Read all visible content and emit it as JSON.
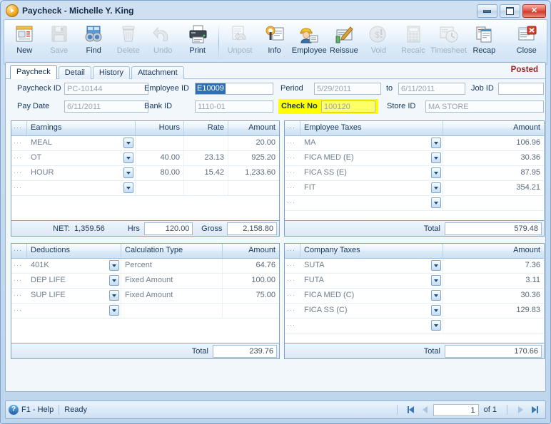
{
  "window": {
    "title": "Paycheck - Michelle Y. King",
    "app_icon": "paycheck-app-icon",
    "minimize_label": "Minimize",
    "maximize_label": "Maximize",
    "close_label": "Close",
    "accent_color": "#2f6fb5",
    "highlight_color": "#ffff00",
    "posted_color": "#9a1f1f"
  },
  "toolbar": {
    "items": [
      {
        "label": "New",
        "icon": "new-document-icon",
        "disabled": false
      },
      {
        "label": "Save",
        "icon": "floppy-disk-icon",
        "disabled": true
      },
      {
        "label": "Find",
        "icon": "binoculars-icon",
        "disabled": false
      },
      {
        "label": "Delete",
        "icon": "trash-can-icon",
        "disabled": true
      },
      {
        "label": "Undo",
        "icon": "undo-arrow-icon",
        "disabled": true
      },
      {
        "label": "Print",
        "icon": "printer-icon",
        "disabled": false
      },
      {
        "label": "Unpost",
        "icon": "unpost-icon",
        "disabled": true
      },
      {
        "label": "Info",
        "icon": "info-icon",
        "disabled": false
      },
      {
        "label": "Employee",
        "icon": "employee-icon",
        "disabled": false
      },
      {
        "label": "Reissue",
        "icon": "reissue-icon",
        "disabled": false
      },
      {
        "label": "Void",
        "icon": "void-icon",
        "disabled": true
      },
      {
        "label": "Recalc",
        "icon": "calculator-icon",
        "disabled": true
      },
      {
        "label": "Timesheet",
        "icon": "timesheet-icon",
        "disabled": true
      },
      {
        "label": "Recap",
        "icon": "recap-icon",
        "disabled": false
      },
      {
        "label": "Close",
        "icon": "close-window-icon",
        "disabled": false
      }
    ]
  },
  "tabs": [
    {
      "label": "Paycheck",
      "active": true
    },
    {
      "label": "Detail",
      "active": false
    },
    {
      "label": "History",
      "active": false
    },
    {
      "label": "Attachment",
      "active": false
    }
  ],
  "status_label": "Posted",
  "form": {
    "paycheck_id": {
      "label": "Paycheck ID",
      "value": "PC-10144"
    },
    "pay_date": {
      "label": "Pay Date",
      "value": "6/11/2011"
    },
    "employee_id": {
      "label": "Employee ID",
      "value": "E10009"
    },
    "bank_id": {
      "label": "Bank ID",
      "value": "1110-01"
    },
    "period": {
      "label": "Period",
      "value": "5/29/2011"
    },
    "period_to": {
      "label": "to",
      "value": "6/11/2011"
    },
    "check_no": {
      "label": "Check No",
      "value": "100120"
    },
    "job_id": {
      "label": "Job ID",
      "value": ""
    },
    "store_id": {
      "label": "Store ID",
      "value": "MA STORE"
    }
  },
  "earnings": {
    "columns": [
      "Earnings",
      "Hours",
      "Rate",
      "Amount"
    ],
    "rows": [
      {
        "name": "MEAL",
        "hours": "",
        "rate": "",
        "amount": "20.00"
      },
      {
        "name": "OT",
        "hours": "40.00",
        "rate": "23.13",
        "amount": "925.20"
      },
      {
        "name": "HOUR",
        "hours": "80.00",
        "rate": "15.42",
        "amount": "1,233.60"
      },
      {
        "name": "",
        "hours": "",
        "rate": "",
        "amount": ""
      }
    ],
    "footer": {
      "net_label": "NET:",
      "net_value": "1,359.56",
      "hrs_label": "Hrs",
      "hrs_value": "120.00",
      "gross_label": "Gross",
      "gross_value": "2,158.80"
    }
  },
  "employee_taxes": {
    "columns": [
      "Employee Taxes",
      "Amount"
    ],
    "rows": [
      {
        "name": "MA",
        "amount": "106.96"
      },
      {
        "name": "FICA MED (E)",
        "amount": "30.36"
      },
      {
        "name": "FICA SS (E)",
        "amount": "87.95"
      },
      {
        "name": "FIT",
        "amount": "354.21"
      },
      {
        "name": "",
        "amount": ""
      }
    ],
    "footer": {
      "label": "Total",
      "value": "579.48"
    }
  },
  "deductions": {
    "columns": [
      "Deductions",
      "Calculation Type",
      "Amount"
    ],
    "rows": [
      {
        "name": "401K",
        "calc": "Percent",
        "amount": "64.76"
      },
      {
        "name": "DEP LIFE",
        "calc": "Fixed Amount",
        "amount": "100.00"
      },
      {
        "name": "SUP LIFE",
        "calc": "Fixed Amount",
        "amount": "75.00"
      },
      {
        "name": "",
        "calc": "",
        "amount": ""
      }
    ],
    "footer": {
      "label": "Total",
      "value": "239.76"
    }
  },
  "company_taxes": {
    "columns": [
      "Company Taxes",
      "Amount"
    ],
    "rows": [
      {
        "name": "SUTA",
        "amount": "7.36"
      },
      {
        "name": "FUTA",
        "amount": "3.11"
      },
      {
        "name": "FICA MED (C)",
        "amount": "30.36"
      },
      {
        "name": "FICA SS (C)",
        "amount": "129.83"
      },
      {
        "name": "",
        "amount": ""
      }
    ],
    "footer": {
      "label": "Total",
      "value": "170.66"
    }
  },
  "statusbar": {
    "help_icon": "help-question-icon",
    "help_label": "F1 - Help",
    "state": "Ready",
    "nav": {
      "first_icon": "first-record-icon",
      "prev_icon": "previous-record-icon",
      "page_value": "1",
      "of_label": "of 1",
      "next_icon": "next-record-icon",
      "last_icon": "last-record-icon"
    }
  },
  "row_handle": "···"
}
